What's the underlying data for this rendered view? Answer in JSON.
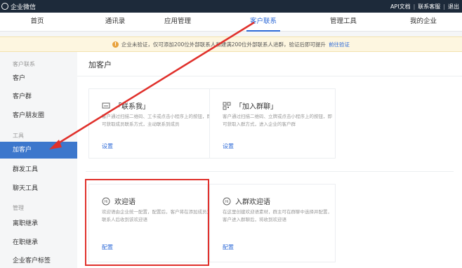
{
  "topbar": {
    "logo_text": "企业微信",
    "links": [
      "API文档",
      "联系客服",
      "退出"
    ]
  },
  "nav": {
    "tabs": [
      {
        "label": "首页",
        "active": false
      },
      {
        "label": "通讯录",
        "active": false
      },
      {
        "label": "应用管理",
        "active": false
      },
      {
        "label": "客户联系",
        "active": true
      },
      {
        "label": "管理工具",
        "active": false
      },
      {
        "label": "我的企业",
        "active": false
      }
    ]
  },
  "notice": {
    "text": "企业未验证，仅可添加200位外部联系人和建满200位外部联系人进群，验证后即可提升",
    "link": "前往验证"
  },
  "sidebar": {
    "group_customer": "客户联系",
    "group_tools": "工具",
    "group_manage": "管理",
    "items": [
      {
        "label": "客户",
        "active": false
      },
      {
        "label": "客户群",
        "active": false
      },
      {
        "label": "客户朋友圈",
        "active": false
      },
      {
        "label": "加客户",
        "active": true
      },
      {
        "label": "群发工具",
        "active": false
      },
      {
        "label": "聊天工具",
        "active": false
      },
      {
        "label": "离职继承",
        "active": false
      },
      {
        "label": "在职继承",
        "active": false
      },
      {
        "label": "企业客户标签",
        "active": false
      }
    ]
  },
  "main": {
    "title": "加客户",
    "cards": [
      {
        "name": "「联系我」",
        "desc": "客户通过扫描二维码、工卡或点击小程序上的按钮，即可获取成员联系方式，主动联系到成员",
        "action": "设置",
        "icon": "chat-icon"
      },
      {
        "name": "「加入群聊」",
        "desc": "客户通过扫描二维码、立牌或点击小程序上的按钮，即可获取入群方式，进入企业的客户群",
        "action": "设置",
        "icon": "qrcode-icon"
      },
      {
        "name": "欢迎语",
        "desc": "欢迎语由企业统一配置，配置后，客户将在添加成员为联系人后收到该欢迎语",
        "action": "配置",
        "icon": "hi-icon"
      },
      {
        "name": "入群欢迎语",
        "desc": "在这里创建欢迎语素材，群主可在群聊中选择并配置，客户进入群聊后，将收到欢迎语",
        "action": "配置",
        "icon": "hi-group-icon"
      }
    ]
  },
  "colors": {
    "accent": "#2e6ad7",
    "sidebar_active": "#3c77cc",
    "highlight": "#e0302b",
    "topbar": "#1d2a3a"
  }
}
